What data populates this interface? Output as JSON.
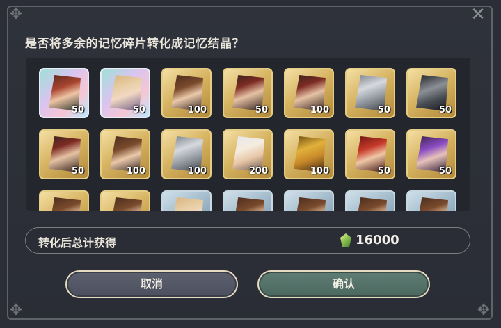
{
  "dialog": {
    "question": "是否将多余的记忆碎片转化成记忆结晶？",
    "close_icon": "close-x"
  },
  "cards": [
    {
      "rarity": "rainbow",
      "art": "teal-bg",
      "count": "50"
    },
    {
      "rarity": "rainbow",
      "art": "hair-light",
      "count": "50"
    },
    {
      "rarity": "gold",
      "art": "hair-brown",
      "count": "100"
    },
    {
      "rarity": "gold",
      "art": "hair-red",
      "count": "50"
    },
    {
      "rarity": "gold",
      "art": "hair-red",
      "count": "100"
    },
    {
      "rarity": "gold",
      "art": "knight",
      "count": "50"
    },
    {
      "rarity": "gold",
      "art": "dark-knight",
      "count": "50"
    },
    {
      "rarity": "gold",
      "art": "hair-red",
      "count": "50"
    },
    {
      "rarity": "gold",
      "art": "hair-brown",
      "count": "100"
    },
    {
      "rarity": "gold",
      "art": "knight",
      "count": "100"
    },
    {
      "rarity": "gold",
      "art": "white",
      "count": "200"
    },
    {
      "rarity": "gold",
      "art": "gold-armor",
      "count": "100"
    },
    {
      "rarity": "gold",
      "art": "red-hood",
      "count": "50"
    },
    {
      "rarity": "gold",
      "art": "purple",
      "count": "50"
    },
    {
      "rarity": "gold",
      "art": "hair-brown",
      "count": ""
    },
    {
      "rarity": "gold",
      "art": "hair-brown",
      "count": ""
    },
    {
      "rarity": "blue",
      "art": "hair-light",
      "count": ""
    },
    {
      "rarity": "blue",
      "art": "hair-brown",
      "count": ""
    },
    {
      "rarity": "blue",
      "art": "hair-brown",
      "count": ""
    },
    {
      "rarity": "blue",
      "art": "hair-brown",
      "count": ""
    },
    {
      "rarity": "blue",
      "art": "hair-brown",
      "count": ""
    }
  ],
  "summary": {
    "label": "转化后总计获得",
    "icon": "memory-crystal-icon",
    "value": "16000"
  },
  "buttons": {
    "cancel_label": "取消",
    "confirm_label": "确认"
  },
  "colors": {
    "background": "#2b2e36",
    "gold_card": "#d7b563",
    "confirm_button": "#5f7d74",
    "cancel_button": "#5c606f"
  }
}
